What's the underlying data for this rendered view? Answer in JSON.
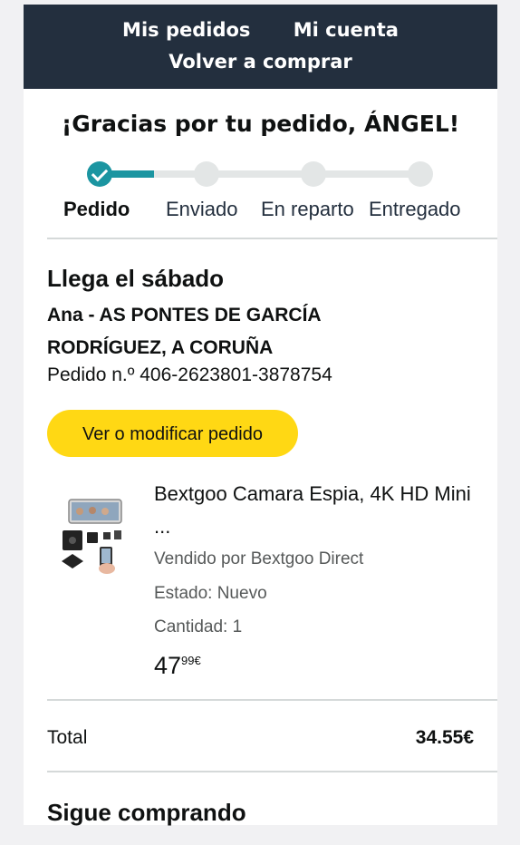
{
  "nav": {
    "orders": "Mis pedidos",
    "account": "Mi cuenta",
    "buy_again": "Volver a comprar"
  },
  "thanks": "¡Gracias por tu pedido, ÁNGEL!",
  "steps": [
    {
      "label": "Pedido",
      "done": true
    },
    {
      "label": "Enviado",
      "done": false
    },
    {
      "label": "En reparto",
      "done": false
    },
    {
      "label": "Entregado",
      "done": false
    }
  ],
  "delivery": {
    "arrives": "Llega el sábado",
    "address": "Ana - AS PONTES DE GARCÍA RODRÍGUEZ, A CORUÑA",
    "order_number": "Pedido n.º 406-2623801-3878754",
    "modify_button": "Ver o modificar pedido"
  },
  "item": {
    "title": "Bextgoo Camara Espia, 4K HD Mini ...",
    "seller": "Vendido por Bextgoo Direct",
    "condition": "Estado: Nuevo",
    "quantity": "Cantidad: 1",
    "price_whole": "47",
    "price_fraction": "99€"
  },
  "total": {
    "label": "Total",
    "value": "34.55€"
  },
  "continue_heading": "Sigue comprando",
  "colors": {
    "nav_bg": "#232f3e",
    "progress": "#1b95a1",
    "button": "#ffd814"
  }
}
